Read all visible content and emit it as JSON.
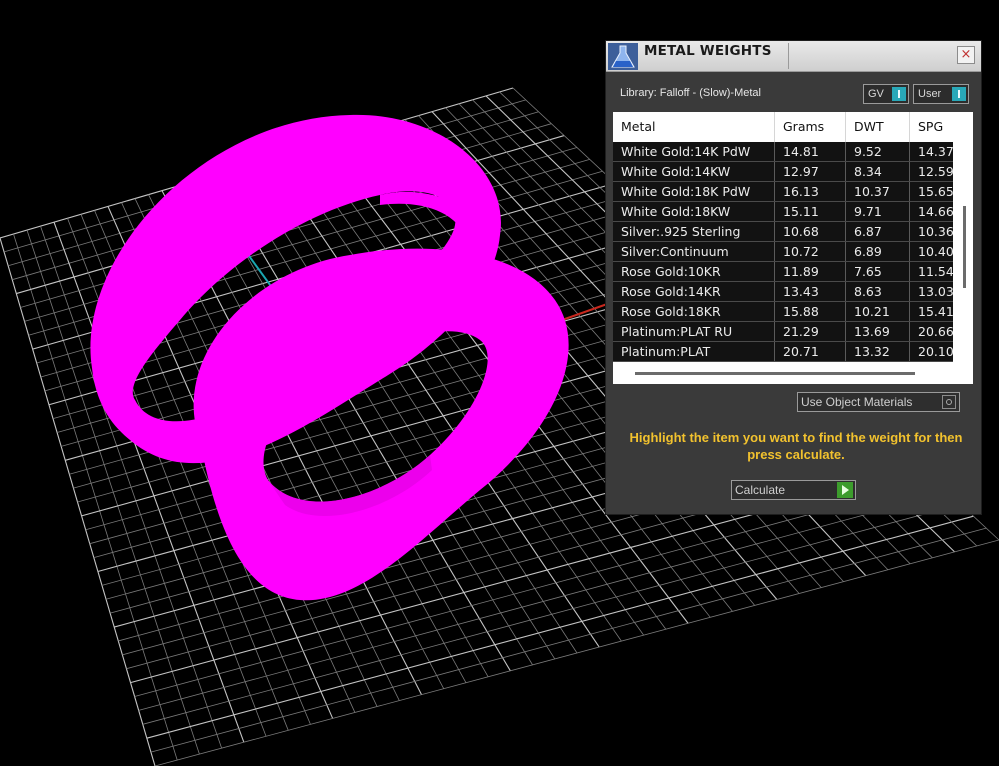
{
  "viewport": {
    "ring_color": "#ff00ff",
    "grid_color": "#b8b8b8",
    "axis_x_color": "#c8281e",
    "axis_z_color": "#1aa6b0"
  },
  "panel": {
    "title": "METAL WEIGHTS",
    "close_label": "×",
    "library": "Library: Falloff - (Slow)-Metal",
    "gv_label": "GV",
    "user_label": "User",
    "columns": [
      "Metal",
      "Grams",
      "DWT",
      "SPG"
    ],
    "rows": [
      {
        "metal": "White Gold:14K PdW",
        "grams": "14.81",
        "dwt": "9.52",
        "spg": "14.37"
      },
      {
        "metal": "White Gold:14KW",
        "grams": "12.97",
        "dwt": "8.34",
        "spg": "12.59"
      },
      {
        "metal": "White Gold:18K PdW",
        "grams": "16.13",
        "dwt": "10.37",
        "spg": "15.65"
      },
      {
        "metal": "White Gold:18KW",
        "grams": "15.11",
        "dwt": "9.71",
        "spg": "14.66"
      },
      {
        "metal": "Silver:.925 Sterling",
        "grams": "10.68",
        "dwt": "6.87",
        "spg": "10.36"
      },
      {
        "metal": "Silver:Continuum",
        "grams": "10.72",
        "dwt": "6.89",
        "spg": "10.40"
      },
      {
        "metal": "Rose Gold:10KR",
        "grams": "11.89",
        "dwt": "7.65",
        "spg": "11.54"
      },
      {
        "metal": "Rose Gold:14KR",
        "grams": "13.43",
        "dwt": "8.63",
        "spg": "13.03"
      },
      {
        "metal": "Rose Gold:18KR",
        "grams": "15.88",
        "dwt": "10.21",
        "spg": "15.41"
      },
      {
        "metal": "Platinum:PLAT RU",
        "grams": "21.29",
        "dwt": "13.69",
        "spg": "20.66"
      },
      {
        "metal": "Platinum:PLAT",
        "grams": "20.71",
        "dwt": "13.32",
        "spg": "20.10"
      }
    ],
    "use_object_materials_label": "Use Object Materials",
    "instruction": "Highlight the item you want to find the weight for then press calculate.",
    "calculate_label": "Calculate",
    "accent_color": "#29a8b8",
    "instruction_color": "#f2c22e",
    "play_color": "#3c9c2c"
  }
}
